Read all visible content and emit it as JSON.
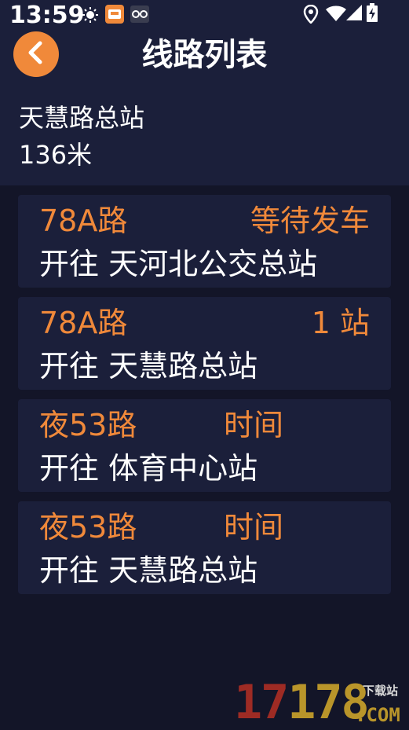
{
  "status_bar": {
    "time": "13:59",
    "icons": [
      "brightness-icon",
      "app-notification-icon",
      "glasses-icon",
      "location-icon",
      "wifi-icon",
      "signal-icon",
      "battery-icon"
    ]
  },
  "header": {
    "title": "线路列表",
    "back_icon": "chevron-left-icon"
  },
  "station": {
    "name": "天慧路总站",
    "distance": "136米"
  },
  "routes": [
    {
      "name": "78A路",
      "status": "等待发车",
      "direction": "开往 天河北公交总站"
    },
    {
      "name": "78A路",
      "status": "1 站",
      "direction": "开往 天慧路总站"
    },
    {
      "name": "夜53路",
      "status": "时间",
      "direction": "开往 体育中心站"
    },
    {
      "name": "夜53路",
      "status": "时间",
      "direction": "开往 天慧路总站"
    }
  ],
  "watermark": {
    "number_red": "17",
    "number_gold": "178",
    "domain": ".COM",
    "label": "下载站"
  },
  "colors": {
    "accent": "#f0893a",
    "background": "#131528",
    "panel": "#1b1f3a",
    "text": "#ffffff"
  }
}
